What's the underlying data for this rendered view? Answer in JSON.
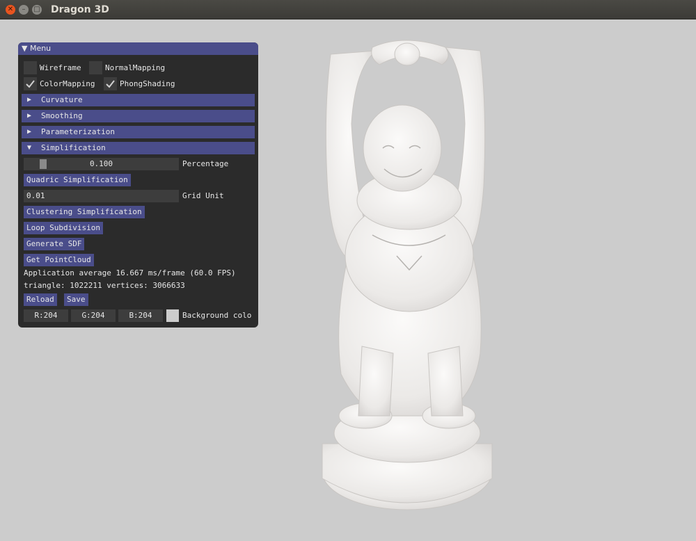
{
  "window": {
    "title": "Dragon 3D",
    "close_glyph": "✕",
    "min_glyph": "–",
    "max_glyph": "□"
  },
  "menu": {
    "title": "▼ Menu",
    "checkboxes": [
      {
        "label": "Wireframe",
        "checked": false
      },
      {
        "label": "NormalMapping",
        "checked": false
      },
      {
        "label": "ColorMapping",
        "checked": true
      },
      {
        "label": "PhongShading",
        "checked": true
      }
    ],
    "headers": [
      {
        "label": "Curvature",
        "expanded": false,
        "arrow": "▶"
      },
      {
        "label": "Smoothing",
        "expanded": false,
        "arrow": "▶"
      },
      {
        "label": "Parameterization",
        "expanded": false,
        "arrow": "▶"
      },
      {
        "label": "Simplification",
        "expanded": true,
        "arrow": "▼"
      }
    ],
    "percentage": {
      "value": "0.100",
      "label": "Percentage",
      "fraction": 0.1
    },
    "quadric_button": "Quadric Simplification",
    "grid_unit": {
      "value": "0.01",
      "label": "Grid Unit"
    },
    "clustering_button": "Clustering Simplification",
    "loop_button": "Loop Subdivision",
    "sdf_button": "Generate SDF",
    "pointcloud_button": "Get PointCloud",
    "fps_text": "Application average 16.667 ms/frame (60.0 FPS)",
    "stats_text": "triangle: 1022211 vertices: 3066633",
    "reload_button": "Reload",
    "save_button": "Save",
    "bg_color": {
      "r": "R:204",
      "g": "G:204",
      "b": "B:204",
      "label": "Background colo",
      "hex": "#cccccc"
    }
  },
  "colors": {
    "accent": "#4a4d8a",
    "panel_bg": "#1a1a1a",
    "viewport_bg": "#cccccc",
    "model": "#f2f0ee"
  }
}
